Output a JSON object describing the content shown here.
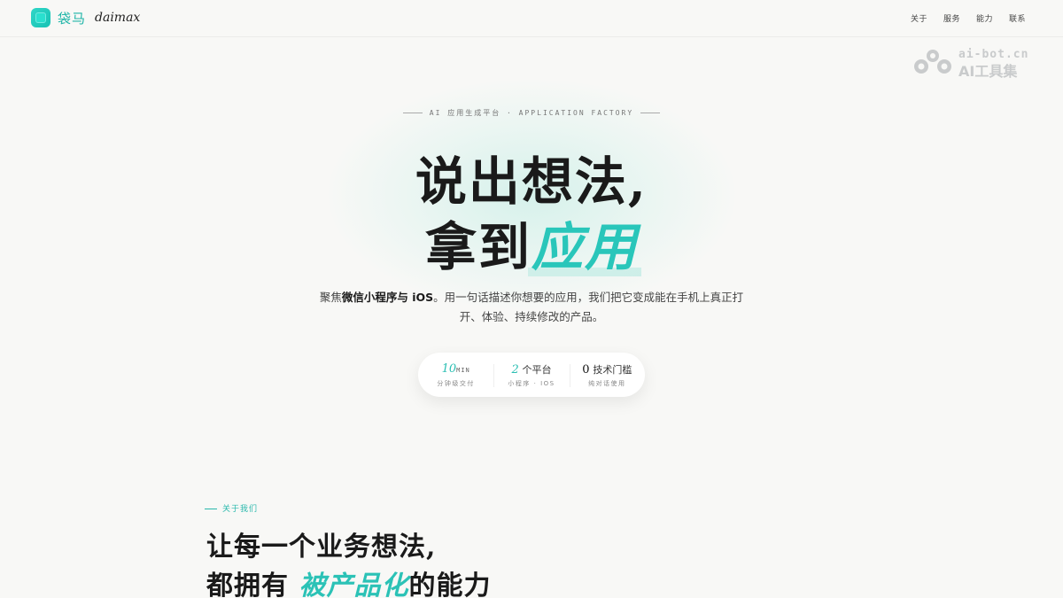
{
  "header": {
    "brand_cn": "袋马",
    "brand_en": "daimax",
    "nav": [
      {
        "label": "关于"
      },
      {
        "label": "服务"
      },
      {
        "label": "能力"
      },
      {
        "label": "联系"
      }
    ]
  },
  "watermark": {
    "url": "ai-bot.cn",
    "name": "AI工具集"
  },
  "hero": {
    "eyebrow": "AI 应用生成平台 · APPLICATION FACTORY",
    "line1": "说出想法,",
    "line2_plain": "拿到",
    "line2_accent": "应用",
    "desc_prefix": "聚焦",
    "desc_bold": "微信小程序与 iOS",
    "desc_rest": "。用一句话描述你想要的应用，我们把它变成能在手机上真正打开、体验、持续修改的产品。"
  },
  "stats": [
    {
      "num": "10",
      "unit": "MIN",
      "label": "分钟级交付"
    },
    {
      "num": "2",
      "unit": "个平台",
      "label": "小程序 · IOS"
    },
    {
      "num": "0",
      "unit": "技术门槛",
      "label": "纯对话使用"
    }
  ],
  "about": {
    "tag": "关于我们",
    "line1": "让每一个业务想法,",
    "line2_prefix": "都拥有 ",
    "line2_accent": "被产品化",
    "line2_suffix": "的能力"
  },
  "colors": {
    "accent": "#2bc2b6",
    "background": "#f8f8f6",
    "text": "#1a1a1a"
  },
  "icons": {
    "logo": "rounded-square-logo-icon",
    "watermark": "ai-bot-logo-icon"
  }
}
